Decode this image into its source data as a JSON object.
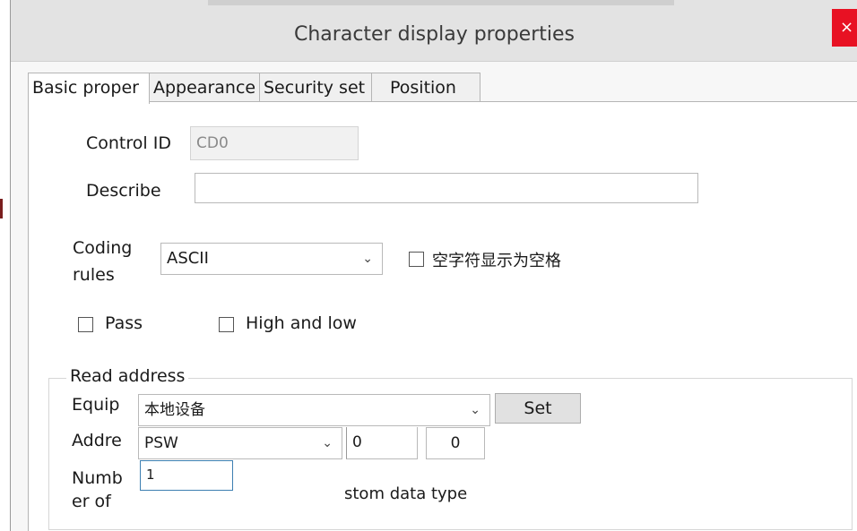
{
  "window": {
    "title": "Character display properties",
    "close_glyph": "×"
  },
  "tabs": [
    {
      "label": "Basic proper",
      "active": true
    },
    {
      "label": "Appearance",
      "active": false
    },
    {
      "label": "Security set",
      "active": false
    },
    {
      "label": "Position",
      "active": false
    }
  ],
  "basic": {
    "control_id_label": "Control ID",
    "control_id_value": "CD0",
    "describe_label": "Describe",
    "describe_value": "",
    "coding_label_1": "Coding",
    "coding_label_2": "rules",
    "coding_value": "ASCII",
    "null_as_space_label": "空字符显示为空格",
    "null_as_space_checked": false,
    "pass_label": "Pass",
    "pass_checked": false,
    "high_low_label": "High and low",
    "high_low_checked": false
  },
  "read_address": {
    "group_label": "Read address",
    "equip_label": "Equip",
    "equip_value": "本地设备",
    "set_label": "Set",
    "addr_label": "Addre",
    "addr_type_value": "PSW",
    "addr_value_1": "0",
    "addr_value_2": "0",
    "number_label_1": "Numb",
    "number_label_2": "er of",
    "number_value": "1",
    "custom_type_partial": "stom data type"
  },
  "icons": {
    "dropdown": "chevron-down-icon",
    "close": "close-icon"
  },
  "colors": {
    "close_bg": "#e81123",
    "focus_border": "#3c7fb1"
  }
}
